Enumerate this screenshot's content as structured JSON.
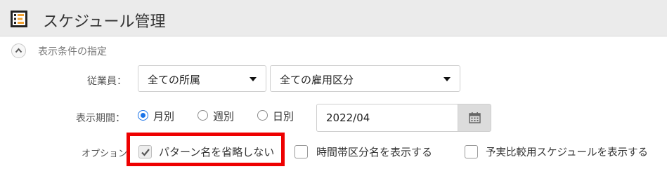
{
  "header": {
    "title": "スケジュール管理",
    "icon": "schedule-list-icon"
  },
  "filter_section": {
    "title": "表示条件の指定",
    "toggle_icon": "chevron-up-icon",
    "employee": {
      "label": "従業員：",
      "department_select": "全ての所属",
      "employment_type_select": "全ての雇用区分"
    },
    "period": {
      "label": "表示期間：",
      "options": [
        "月別",
        "週別",
        "日別"
      ],
      "selected": "月別",
      "date_value": "2022/04",
      "calendar_icon": "calendar-icon"
    },
    "options": {
      "label": "オプション",
      "items": [
        {
          "label": "パターン名を省略しない",
          "checked": true,
          "highlighted": true
        },
        {
          "label": "時間帯区分名を表示する",
          "checked": false
        },
        {
          "label": "予実比較用スケジュールを表示する",
          "checked": false
        }
      ]
    }
  },
  "colors": {
    "accent": "#1a73e8",
    "highlight": "#ee0000",
    "header_bg": "#ebebeb",
    "icon_orange": "#f0a030"
  }
}
